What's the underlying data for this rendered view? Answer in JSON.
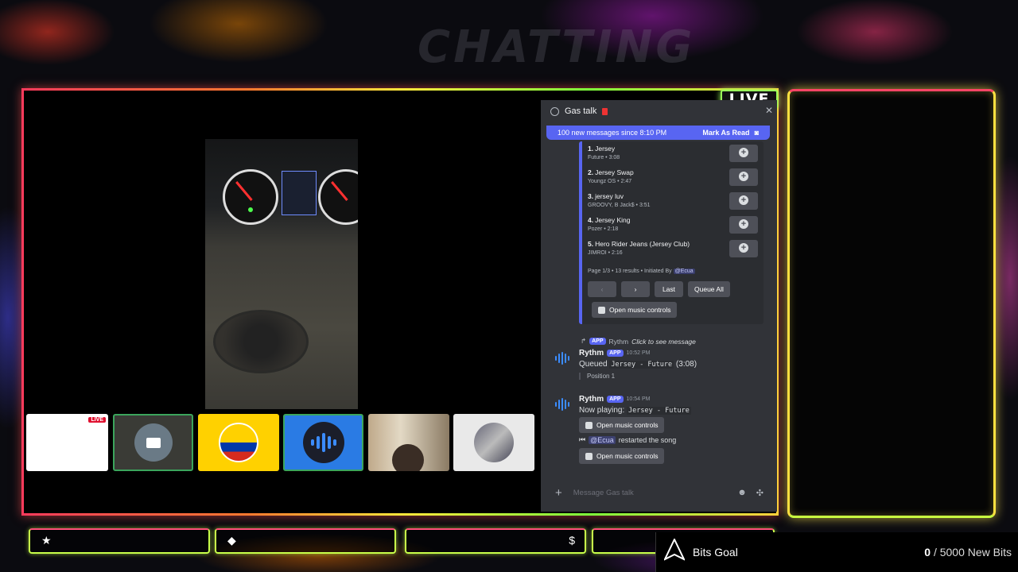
{
  "overlay": {
    "faded_title": "CHATTING",
    "live_badge": "LIVE"
  },
  "tiles": {
    "chat_preview_live": "LIVE"
  },
  "discord": {
    "channel": "Gas talk",
    "banner_text": "100 new messages since 8:10 PM",
    "mark_as_read": "Mark As Read",
    "songs": [
      {
        "num": "1.",
        "title": "Jersey",
        "meta": "Future • 3:08"
      },
      {
        "num": "2.",
        "title": "Jersey Swap",
        "meta": "Youngz OS • 2:47"
      },
      {
        "num": "3.",
        "title": "jersey luv",
        "meta": "GROOVY, B Jack$ • 3:51"
      },
      {
        "num": "4.",
        "title": "Jersey King",
        "meta": "Pozer • 2:18"
      },
      {
        "num": "5.",
        "title": "Hero Rider Jeans (Jersey Club)",
        "meta": "JIMROI • 2:16"
      }
    ],
    "embed_footer": "Page 1/3 • 13 results • Initiated By",
    "embed_footer_mention": "@Ecua",
    "nav": {
      "prev": "‹",
      "next": "›",
      "last": "Last",
      "queue_all": "Queue All"
    },
    "open_controls": "Open music controls",
    "reply": {
      "app_tag": "APP",
      "author": "Rythm",
      "text": "Click to see message"
    },
    "message1": {
      "name": "Rythm",
      "app_tag": "APP",
      "time": "10:52 PM",
      "prefix": "Queued",
      "code": "Jersey - Future",
      "suffix": "(3:08)",
      "position": "Position 1"
    },
    "message2": {
      "name": "Rythm",
      "app_tag": "APP",
      "time": "10:54 PM",
      "prefix": "Now playing:",
      "code": "Jersey - Future",
      "open_controls": "Open music controls",
      "restart_mention": "@Ecua",
      "restart_text": "restarted the song",
      "open_controls_2": "Open music controls"
    },
    "composer_placeholder": "Message Gas talk"
  },
  "bottom": {
    "slot1_glyph": "★",
    "slot2_glyph": "◆",
    "slot3_glyph": "$"
  },
  "bits_goal": {
    "label": "Bits Goal",
    "current": "0",
    "target": "/ 5000 New Bits"
  }
}
